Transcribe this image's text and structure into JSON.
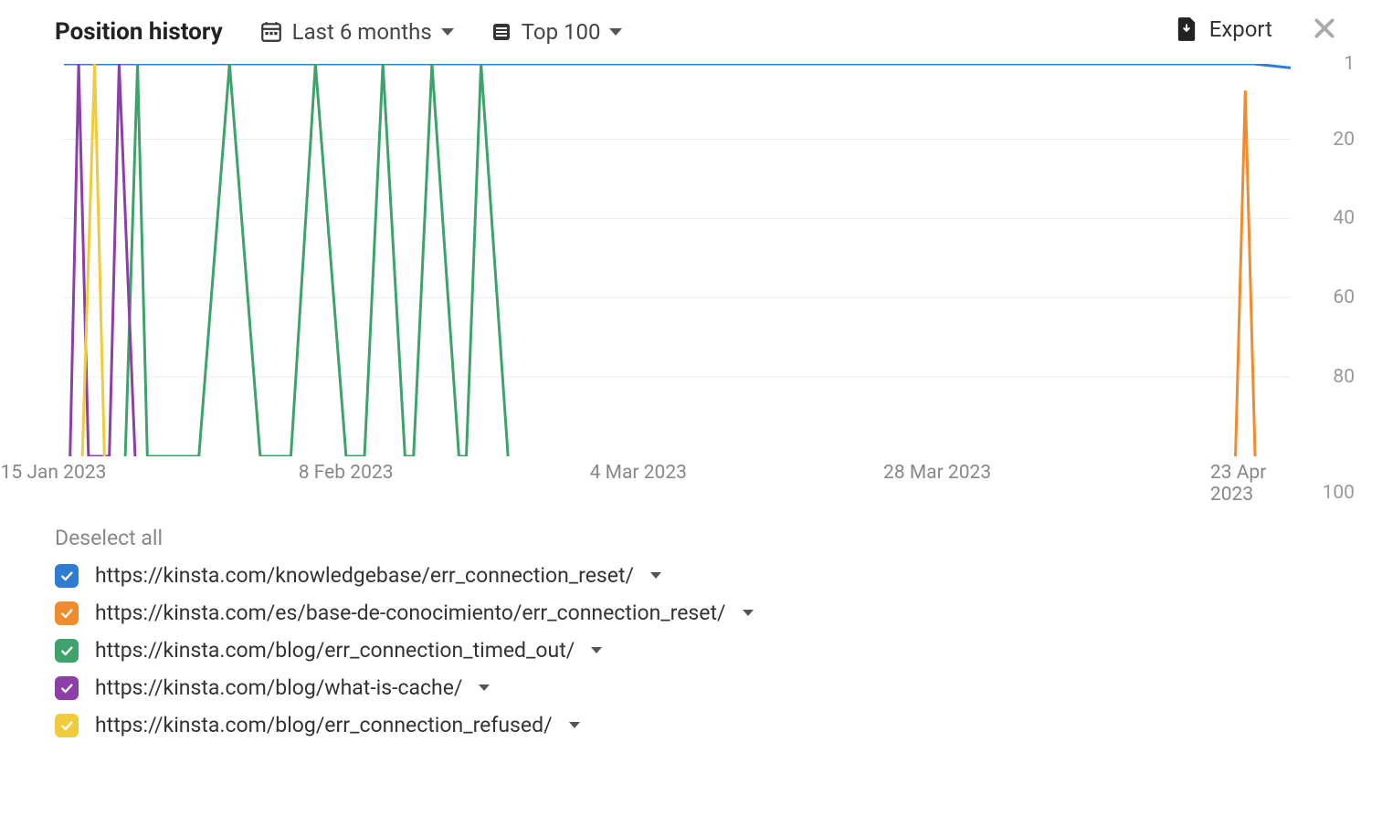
{
  "header": {
    "title": "Position history",
    "date_filter": "Last 6 months",
    "top_filter": "Top 100",
    "export_label": "Export"
  },
  "legend": {
    "deselect_label": "Deselect all",
    "items": [
      {
        "color": "#2f7dd1",
        "url": "https://kinsta.com/knowledgebase/err_connection_reset/"
      },
      {
        "color": "#f08c2e",
        "url": "https://kinsta.com/es/base-de-conocimiento/err_connection_reset/"
      },
      {
        "color": "#3ea36a",
        "url": "https://kinsta.com/blog/err_connection_timed_out/"
      },
      {
        "color": "#8d3fa8",
        "url": "https://kinsta.com/blog/what-is-cache/"
      },
      {
        "color": "#f0cc3c",
        "url": "https://kinsta.com/blog/err_connection_refused/"
      }
    ]
  },
  "chart_data": {
    "type": "line",
    "title": "Position history",
    "xlabel": "",
    "ylabel": "",
    "ylim": [
      1,
      100
    ],
    "y_ticks": [
      1,
      20,
      40,
      60,
      80,
      100
    ],
    "x_ticks": [
      "15 Jan 2023",
      "8 Feb 2023",
      "4 Mar 2023",
      "28 Mar 2023",
      "23 Apr 2023"
    ],
    "x_tick_positions": [
      0.02,
      0.245,
      0.47,
      0.7,
      0.94
    ],
    "series": [
      {
        "name": "https://kinsta.com/knowledgebase/err_connection_reset/",
        "color": "#2f7dd1",
        "x": [
          0.0,
          0.97,
          1.0
        ],
        "values": [
          1,
          1,
          2
        ]
      },
      {
        "name": "https://kinsta.com/es/base-de-conocimiento/err_connection_reset/",
        "color": "#f08c2e",
        "x": [
          0.955,
          0.963,
          0.971
        ],
        "values": [
          100,
          8,
          100
        ]
      },
      {
        "name": "https://kinsta.com/blog/err_connection_timed_out/",
        "color": "#3ea36a",
        "x": [
          0.05,
          0.06,
          0.068,
          0.11,
          0.135,
          0.16,
          0.185,
          0.205,
          0.23,
          0.245,
          0.26,
          0.278,
          0.285,
          0.3,
          0.322,
          0.328,
          0.34,
          0.362
        ],
        "values": [
          100,
          1,
          100,
          100,
          1,
          100,
          100,
          1,
          100,
          100,
          1,
          100,
          100,
          1,
          100,
          100,
          1,
          100
        ]
      },
      {
        "name": "https://kinsta.com/blog/what-is-cache/",
        "color": "#8d3fa8",
        "x": [
          0.005,
          0.012,
          0.02,
          0.037,
          0.045,
          0.058
        ],
        "values": [
          100,
          1,
          100,
          100,
          1,
          100
        ]
      },
      {
        "name": "https://kinsta.com/blog/err_connection_refused/",
        "color": "#f0cc3c",
        "x": [
          0.015,
          0.025,
          0.033
        ],
        "values": [
          100,
          1,
          100
        ]
      }
    ]
  }
}
